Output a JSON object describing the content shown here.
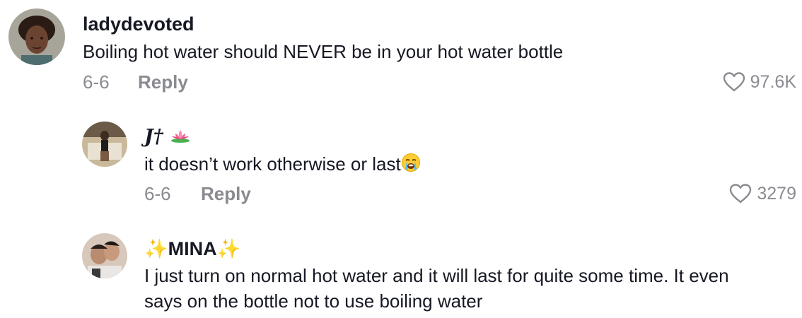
{
  "comments": [
    {
      "username": "ladydevoted",
      "text": "Boiling hot water should NEVER be in your hot water bottle",
      "date": "6-6",
      "reply_label": "Reply",
      "likes": "97.6K"
    },
    {
      "username": "J†",
      "username_emoji": "lotus-emoji",
      "text": "it doesn’t work otherwise or last",
      "text_emoji": "loudly-crying-face-emoji",
      "date": "6-6",
      "reply_label": "Reply",
      "likes": "3279"
    },
    {
      "username_prefix": "✨",
      "username": "MINA",
      "username_suffix": "✨",
      "text": "I just turn on normal hot water and it will last for quite some time. It even says on the bottle not to use boiling water"
    }
  ],
  "icons": {
    "like": "heart-outline-icon"
  },
  "colors": {
    "text": "#161823",
    "secondary": "#8a8b91",
    "background": "#ffffff"
  }
}
